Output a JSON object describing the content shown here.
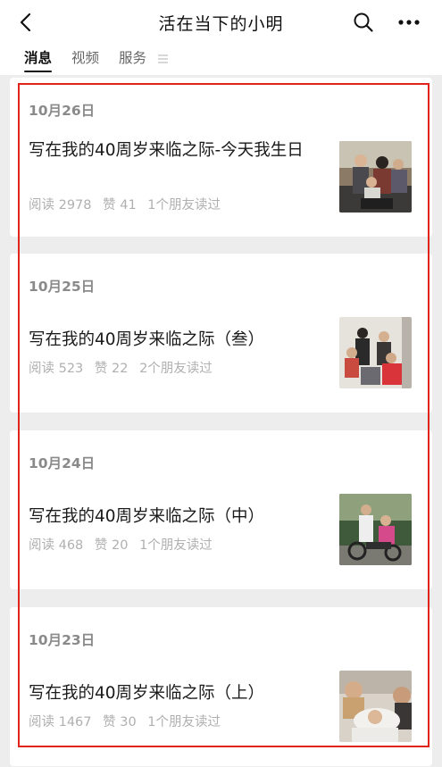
{
  "navbar": {
    "title": "活在当下的小明",
    "back_icon": "chevron-left-icon",
    "search_icon": "search-icon",
    "more_icon": "more-dots-icon"
  },
  "tabs": [
    {
      "label": "消息",
      "active": true
    },
    {
      "label": "视频",
      "active": false
    },
    {
      "label": "服务",
      "active": false
    }
  ],
  "articles": [
    {
      "date": "10月26日",
      "title": "写在我的40周岁来临之际-今天我生日",
      "reads": "阅读 2978",
      "likes": "赞 41",
      "friends": "1个朋友读过"
    },
    {
      "date": "10月25日",
      "title": "写在我的40周岁来临之际（叁）",
      "reads": "阅读 523",
      "likes": "赞 22",
      "friends": "2个朋友读过"
    },
    {
      "date": "10月24日",
      "title": "写在我的40周岁来临之际（中）",
      "reads": "阅读 468",
      "likes": "赞 20",
      "friends": "1个朋友读过"
    },
    {
      "date": "10月23日",
      "title": "写在我的40周岁来临之际（上）",
      "reads": "阅读 1467",
      "likes": "赞 30",
      "friends": "1个朋友读过"
    }
  ],
  "colors": {
    "highlight": "#e2231a",
    "background": "#ededed"
  }
}
